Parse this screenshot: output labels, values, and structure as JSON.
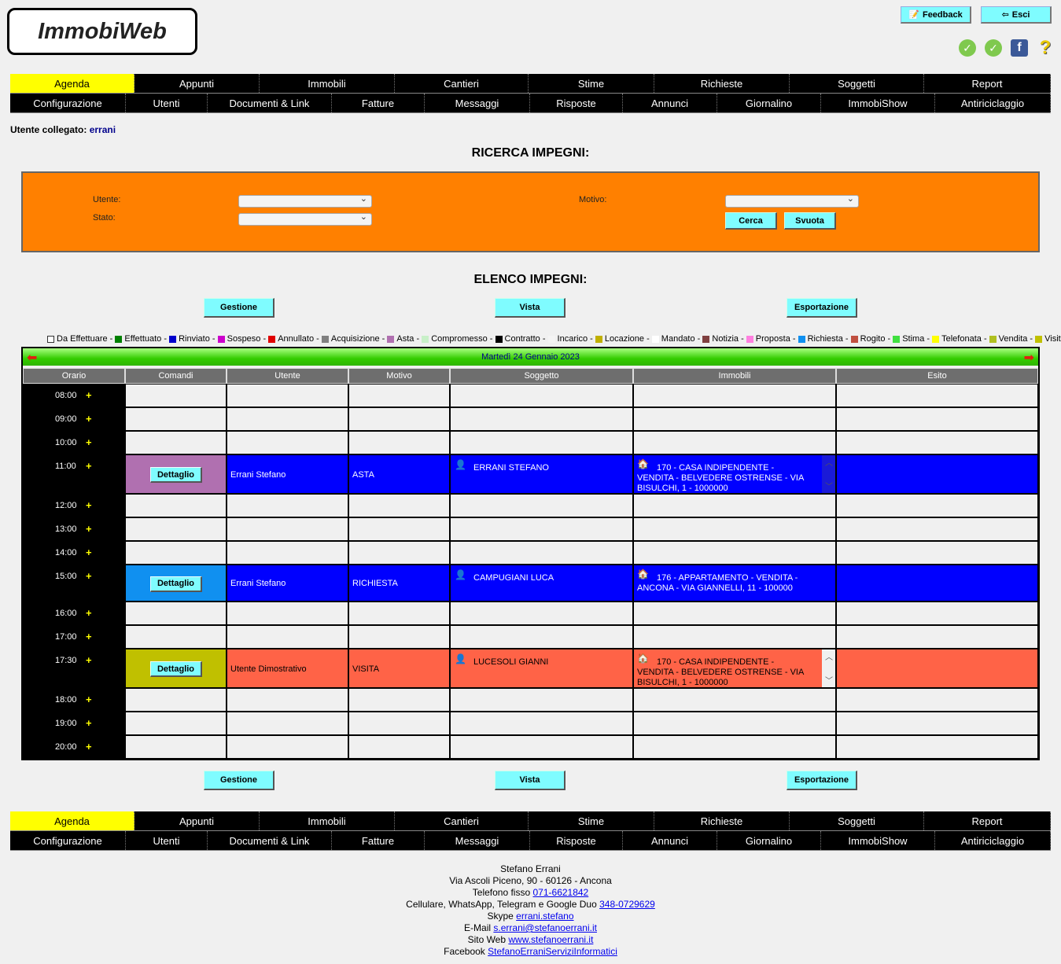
{
  "app": {
    "logo": "ImmobiWeb"
  },
  "top_buttons": {
    "feedback": "Feedback",
    "exit": "Esci"
  },
  "menu_row1": [
    "Agenda",
    "Appunti",
    "Immobili",
    "Cantieri",
    "Stime",
    "Richieste",
    "Soggetti",
    "Report"
  ],
  "menu_row2": [
    "Configurazione",
    "Utenti",
    "Documenti & Link",
    "Fatture",
    "Messaggi",
    "Risposte",
    "Annunci",
    "Giornalino",
    "ImmobiShow",
    "Antiriciclaggio"
  ],
  "user": {
    "label": "Utente collegato:",
    "name": "errani"
  },
  "search": {
    "title": "RICERCA IMPEGNI:",
    "utente_label": "Utente:",
    "stato_label": "Stato:",
    "motivo_label": "Motivo:",
    "cerca": "Cerca",
    "svuota": "Svuota"
  },
  "list": {
    "title": "ELENCO IMPEGNI:",
    "gestione": "Gestione",
    "vista": "Vista",
    "esportazione": "Esportazione"
  },
  "legend": [
    {
      "label": "Da Effettuare",
      "color": "#ffffff",
      "border": true
    },
    {
      "label": "Effettuato",
      "color": "#008000"
    },
    {
      "label": "Rinviato",
      "color": "#0000cc"
    },
    {
      "label": "Sospeso",
      "color": "#cc00cc"
    },
    {
      "label": "Annullato",
      "color": "#e00000"
    },
    {
      "label": "Acquisizione",
      "color": "#808080"
    },
    {
      "label": "Asta",
      "color": "#b070b0"
    },
    {
      "label": "Compromesso",
      "color": "#c8f0c8"
    },
    {
      "label": "Contratto",
      "color": "#000000"
    },
    {
      "label": "Incarico",
      "color": "#f4f4f4"
    },
    {
      "label": "Locazione",
      "color": "#c0b000"
    },
    {
      "label": "Mandato",
      "color": "#ffffff"
    },
    {
      "label": "Notizia",
      "color": "#804040"
    },
    {
      "label": "Proposta",
      "color": "#ff80e0"
    },
    {
      "label": "Richiesta",
      "color": "#1090f0"
    },
    {
      "label": "Rogito",
      "color": "#c05040"
    },
    {
      "label": "Stima",
      "color": "#40e040"
    },
    {
      "label": "Telefonata",
      "color": "#ffff00"
    },
    {
      "label": "Vendita",
      "color": "#b0c020"
    },
    {
      "label": "Visita",
      "color": "#c0c000"
    }
  ],
  "calendar": {
    "date": "Martedì 24 Gennaio 2023",
    "columns": [
      "Orario",
      "Comandi",
      "Utente",
      "Motivo",
      "Soggetto",
      "Immobili",
      "Esito"
    ],
    "rows": [
      {
        "time": "08:00"
      },
      {
        "time": "09:00"
      },
      {
        "time": "10:00"
      },
      {
        "time": "11:00",
        "detail": "Dettaglio",
        "cmd_color": "#b070b0",
        "row_color": "#0000ff",
        "text_color": "#ffffff",
        "utente": "Errani Stefano",
        "motivo": "ASTA",
        "soggetto": "ERRANI STEFANO",
        "immobile": "170 - CASA INDIPENDENTE - VENDITA - BELVEDERE OSTRENSE - VIA BISULCHI, 1 - 1000000",
        "scroll": true
      },
      {
        "time": "12:00"
      },
      {
        "time": "13:00"
      },
      {
        "time": "14:00"
      },
      {
        "time": "15:00",
        "detail": "Dettaglio",
        "cmd_color": "#1090f0",
        "row_color": "#0000ff",
        "text_color": "#ffffff",
        "utente": "Errani Stefano",
        "motivo": "RICHIESTA",
        "soggetto": "CAMPUGIANI LUCA",
        "immobile": "176 - APPARTAMENTO - VENDITA - ANCONA - VIA GIANNELLI, 11 - 100000",
        "scroll": false
      },
      {
        "time": "16:00"
      },
      {
        "time": "17:00"
      },
      {
        "time": "17:30",
        "detail": "Dettaglio",
        "cmd_color": "#c0c000",
        "row_color": "#ff6347",
        "text_color": "#000000",
        "utente": "Utente Dimostrativo",
        "motivo": "VISITA",
        "soggetto": "LUCESOLI GIANNI",
        "immobile": "170 - CASA INDIPENDENTE - VENDITA - BELVEDERE OSTRENSE - VIA BISULCHI, 1 - 1000000",
        "scroll": true
      },
      {
        "time": "18:00"
      },
      {
        "time": "19:00"
      },
      {
        "time": "20:00"
      }
    ]
  },
  "footer": {
    "name": "Stefano Errani",
    "address": "Via Ascoli Piceno, 90 - 60126 - Ancona",
    "phone_label": "Telefono fisso",
    "phone": "071-6621842",
    "mobile_label": "Cellulare, WhatsApp, Telegram e Google Duo",
    "mobile": "348-0729629",
    "skype_label": "Skype",
    "skype": "errani.stefano",
    "email_label": "E-Mail",
    "email": "s.errani@stefanoerrani.it",
    "web_label": "Sito Web",
    "web": "www.stefanoerrani.it",
    "facebook_label": "Facebook",
    "facebook": "StefanoErraniServiziInformatici"
  }
}
